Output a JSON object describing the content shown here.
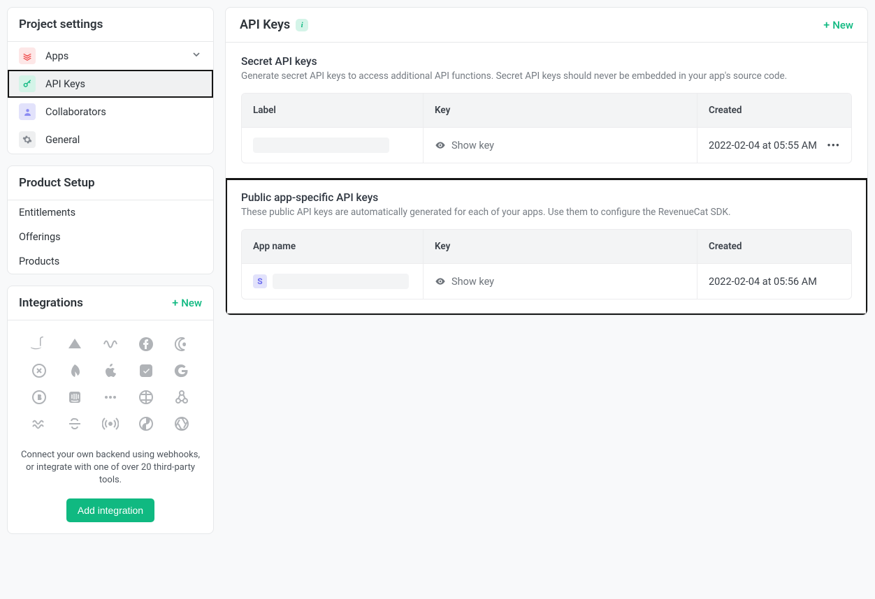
{
  "sidebar": {
    "project_settings": {
      "title": "Project settings",
      "items": [
        {
          "label": "Apps",
          "icon": "layers-icon"
        },
        {
          "label": "API Keys",
          "icon": "key-icon"
        },
        {
          "label": "Collaborators",
          "icon": "person-icon"
        },
        {
          "label": "General",
          "icon": "gear-icon"
        }
      ]
    },
    "product_setup": {
      "title": "Product Setup",
      "items": [
        {
          "label": "Entitlements"
        },
        {
          "label": "Offerings"
        },
        {
          "label": "Products"
        }
      ]
    },
    "integrations": {
      "title": "Integrations",
      "new_label": "New",
      "blurb": "Connect your own backend using webhooks, or integrate with one of over 20 third-party tools.",
      "button": "Add integration"
    }
  },
  "page": {
    "title": "API Keys",
    "new_label": "New"
  },
  "secret": {
    "title": "Secret API keys",
    "desc": "Generate secret API keys to access additional API functions. Secret API keys should never be embedded in your app's source code.",
    "columns": {
      "label": "Label",
      "key": "Key",
      "created": "Created"
    },
    "rows": [
      {
        "show_key": "Show key",
        "created": "2022-02-04 at 05:55 AM"
      }
    ]
  },
  "public": {
    "title": "Public app-specific API keys",
    "desc": "These public API keys are automatically generated for each of your apps. Use them to configure the RevenueCat SDK.",
    "columns": {
      "app_name": "App name",
      "key": "Key",
      "created": "Created"
    },
    "rows": [
      {
        "badge": "S",
        "show_key": "Show key",
        "created": "2022-02-04 at 05:56 AM"
      }
    ]
  }
}
